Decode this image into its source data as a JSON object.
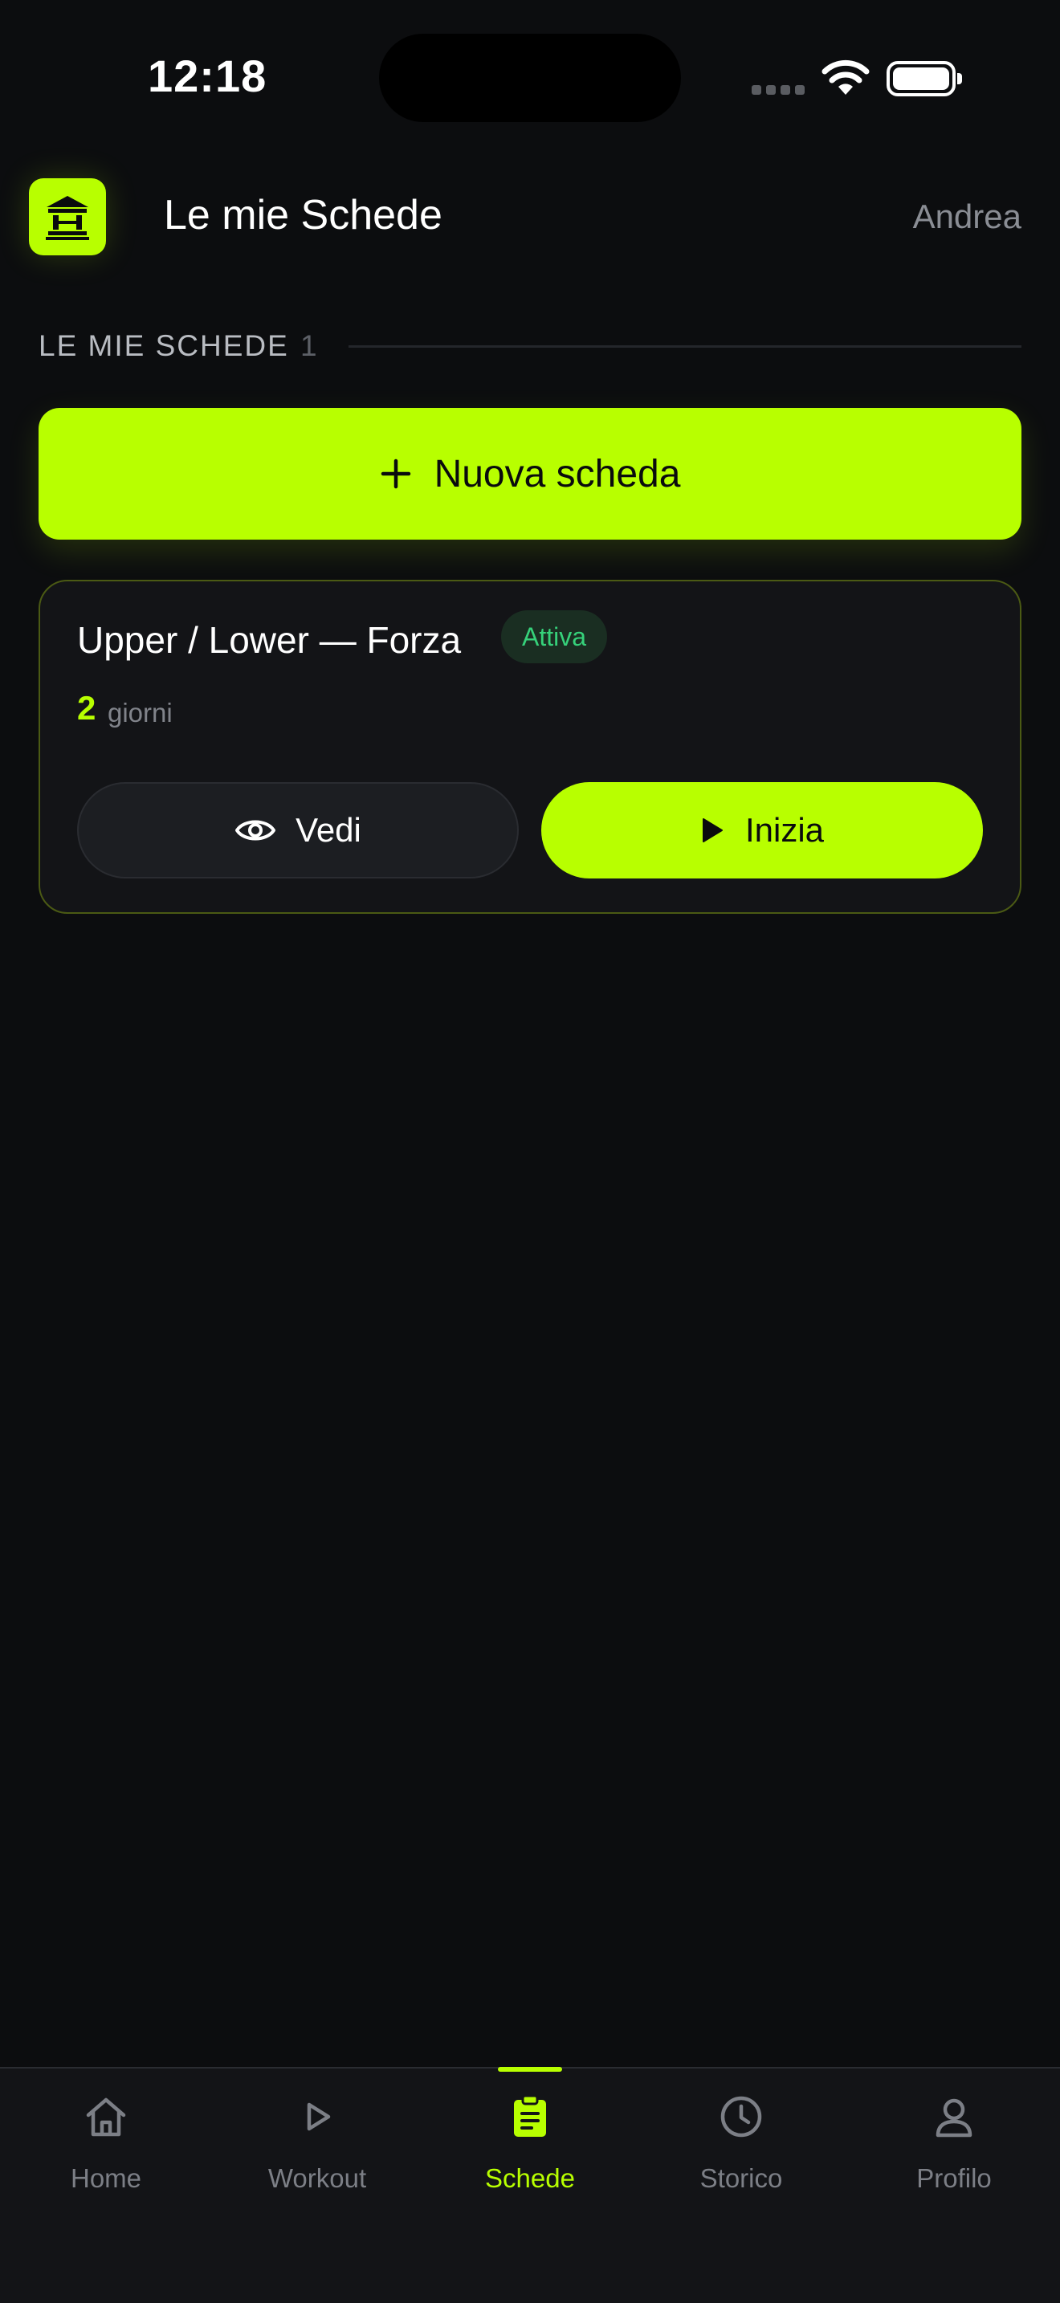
{
  "status_bar": {
    "time": "12:18"
  },
  "header": {
    "title": "Le mie Schede",
    "user": "Andrea",
    "logo_icon": "gym-building-icon"
  },
  "section": {
    "label": "LE MIE SCHEDE",
    "count": "1"
  },
  "new_button": {
    "label": "Nuova scheda",
    "icon": "plus-icon"
  },
  "plans": [
    {
      "name": "Upper / Lower — Forza",
      "status": "Attiva",
      "days_count": "2",
      "days_label": "giorni",
      "view_label": "Vedi",
      "start_label": "Inizia"
    }
  ],
  "tabs": [
    {
      "label": "Home",
      "icon": "home-icon",
      "active": false
    },
    {
      "label": "Workout",
      "icon": "play-icon",
      "active": false
    },
    {
      "label": "Schede",
      "icon": "clipboard-icon",
      "active": true
    },
    {
      "label": "Storico",
      "icon": "clock-icon",
      "active": false
    },
    {
      "label": "Profilo",
      "icon": "user-icon",
      "active": false
    }
  ],
  "colors": {
    "accent": "#b8ff00",
    "background": "#0c0d0f",
    "card": "#131417",
    "badge_text": "#36d17a"
  }
}
